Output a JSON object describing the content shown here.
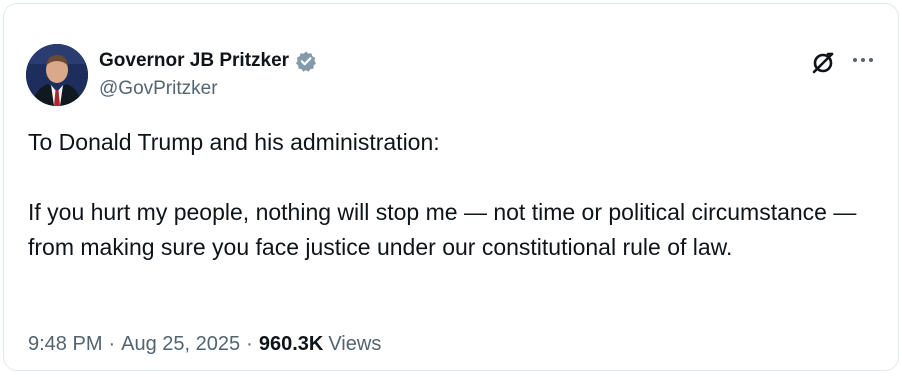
{
  "author": {
    "display_name": "Governor JB Pritzker",
    "handle": "@GovPritzker",
    "verified": true,
    "verified_color": "#829aab"
  },
  "icons": {
    "grok": "grok-icon",
    "more": "more-options-icon",
    "verified": "verified-badge-icon"
  },
  "tweet": {
    "paragraphs": [
      "To Donald Trump and his administration:",
      "If you hurt my people, nothing will stop me — not time or political circumstance — from making sure you face justice under our constitutional rule of law."
    ]
  },
  "meta": {
    "time": "9:48 PM",
    "separator": "·",
    "date": "Aug 25, 2025",
    "view_count": "960.3K",
    "views_label": "Views"
  }
}
